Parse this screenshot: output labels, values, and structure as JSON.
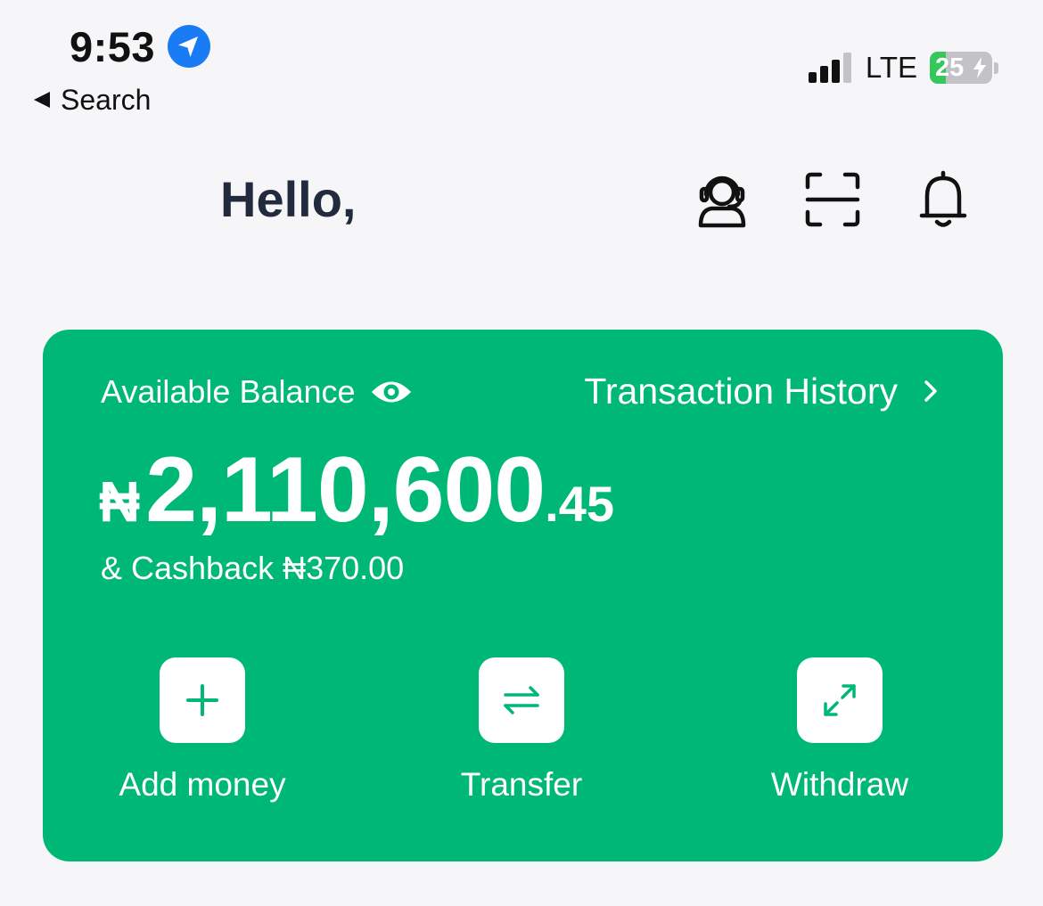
{
  "status_bar": {
    "time": "9:53",
    "back_label": "Search",
    "network": "LTE",
    "battery_percent": 25,
    "battery_text": "25"
  },
  "header": {
    "greeting": "Hello,"
  },
  "balance_card": {
    "label": "Available Balance",
    "history_label": "Transaction History",
    "currency_symbol": "₦",
    "amount_whole": "2,110,600",
    "amount_decimal": ".45",
    "cashback": "& Cashback ₦370.00"
  },
  "actions": [
    {
      "label": "Add money",
      "icon": "plus-icon"
    },
    {
      "label": "Transfer",
      "icon": "transfer-arrows-icon"
    },
    {
      "label": "Withdraw",
      "icon": "expand-arrows-icon"
    }
  ],
  "colors": {
    "card_green": "#00b876",
    "page_background": "#f6f6f9",
    "heading_text": "#222a3d",
    "location_blue": "#1a7cf5",
    "battery_green": "#34c759"
  }
}
